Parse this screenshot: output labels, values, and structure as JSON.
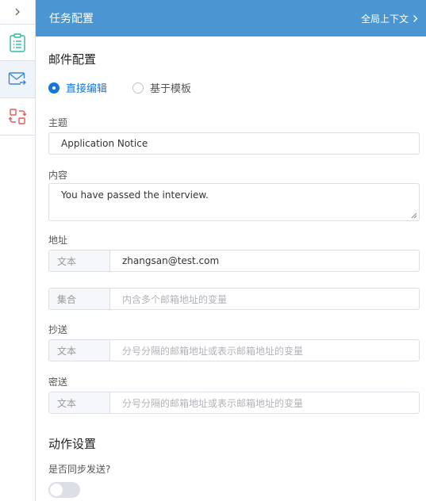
{
  "rail": {
    "toggle_icon": "chevron-right-icon",
    "items": [
      {
        "icon": "checklist-icon",
        "color": "#2bbf9c"
      },
      {
        "icon": "mail-forward-icon",
        "color": "#3b86d9"
      },
      {
        "icon": "swap-icon",
        "color": "#e05a5a"
      }
    ]
  },
  "header": {
    "title": "任务配置",
    "link": "全局上下文",
    "bg_color": "#4a96d2"
  },
  "mail": {
    "section_title": "邮件配置",
    "mode_options": [
      {
        "label": "直接编辑",
        "checked": true
      },
      {
        "label": "基于模板",
        "checked": false
      }
    ],
    "subject_label": "主题",
    "subject_value": "Application Notice",
    "content_label": "内容",
    "content_value": "You have passed the interview.",
    "address_label": "地址",
    "address_type": "文本",
    "address_value": "zhangsan@test.com",
    "collection_type": "集合",
    "collection_placeholder": "内含多个邮箱地址的变量",
    "cc_label": "抄送",
    "cc_type": "文本",
    "cc_placeholder": "分号分隔的邮箱地址或表示邮箱地址的变量",
    "bcc_label": "密送",
    "bcc_type": "文本",
    "bcc_placeholder": "分号分隔的邮箱地址或表示邮箱地址的变量"
  },
  "action": {
    "section_title": "动作设置",
    "sync_label": "是否同步发送?",
    "sync_enabled": false
  },
  "accent_color": "#1677d9"
}
